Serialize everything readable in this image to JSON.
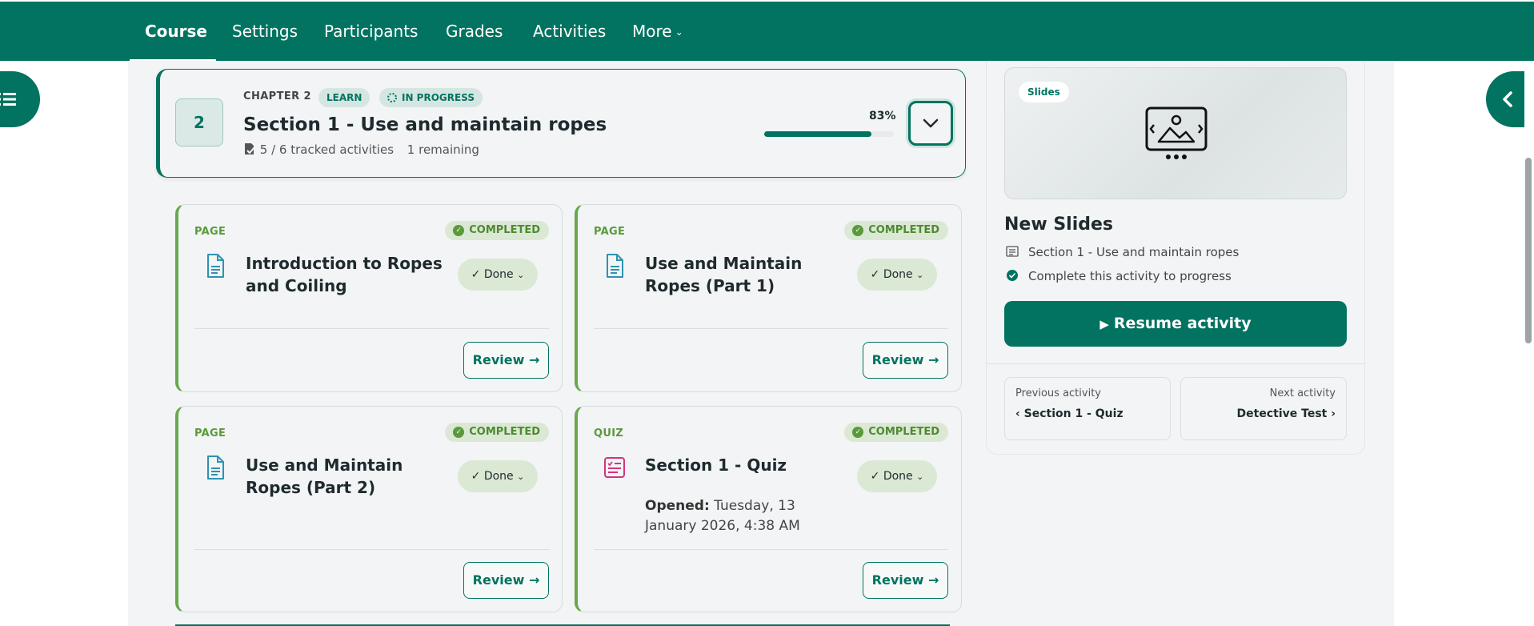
{
  "topnav": {
    "tabs": [
      {
        "label": "Course",
        "active": true
      },
      {
        "label": "Settings"
      },
      {
        "label": "Participants"
      },
      {
        "label": "Grades"
      },
      {
        "label": "Activities"
      },
      {
        "label": "More"
      }
    ],
    "bg_color": "#027360"
  },
  "chapter": {
    "number": "2",
    "label": "CHAPTER 2",
    "badge_learn": "LEARN",
    "badge_status": "IN PROGRESS",
    "title": "Section 1 - Use and maintain ropes",
    "tracked": "5 / 6 tracked activities",
    "remaining": "1 remaining",
    "progress_label": "83%",
    "progress": 0.83
  },
  "cards": [
    {
      "type": "PAGE",
      "status": "COMPLETED",
      "title": "Introduction to Ropes and Coiling",
      "done_label": "Done",
      "review_label": "Review"
    },
    {
      "type": "PAGE",
      "status": "COMPLETED",
      "title": "Use and Maintain Ropes (Part 1)",
      "done_label": "Done",
      "review_label": "Review"
    },
    {
      "type": "PAGE",
      "status": "COMPLETED",
      "title": "Use and Maintain Ropes (Part 2)",
      "done_label": "Done",
      "review_label": "Review"
    },
    {
      "type": "QUIZ",
      "status": "COMPLETED",
      "title": "Section 1 - Quiz",
      "opened_label": "Opened:",
      "opened_value": "Tuesday, 13 January 2026, 4:38 AM",
      "done_label": "Done",
      "review_label": "Review"
    }
  ],
  "panel": {
    "preview_pill": "Slides",
    "title": "New Slides",
    "section": "Section 1 - Use and maintain ropes",
    "completion": "Complete this activity to progress",
    "resume_label": "Resume activity",
    "prev_label": "Previous activity",
    "prev_value": "‹ Section 1 - Quiz",
    "next_label": "Next activity",
    "next_value": "Detective Test ›"
  }
}
